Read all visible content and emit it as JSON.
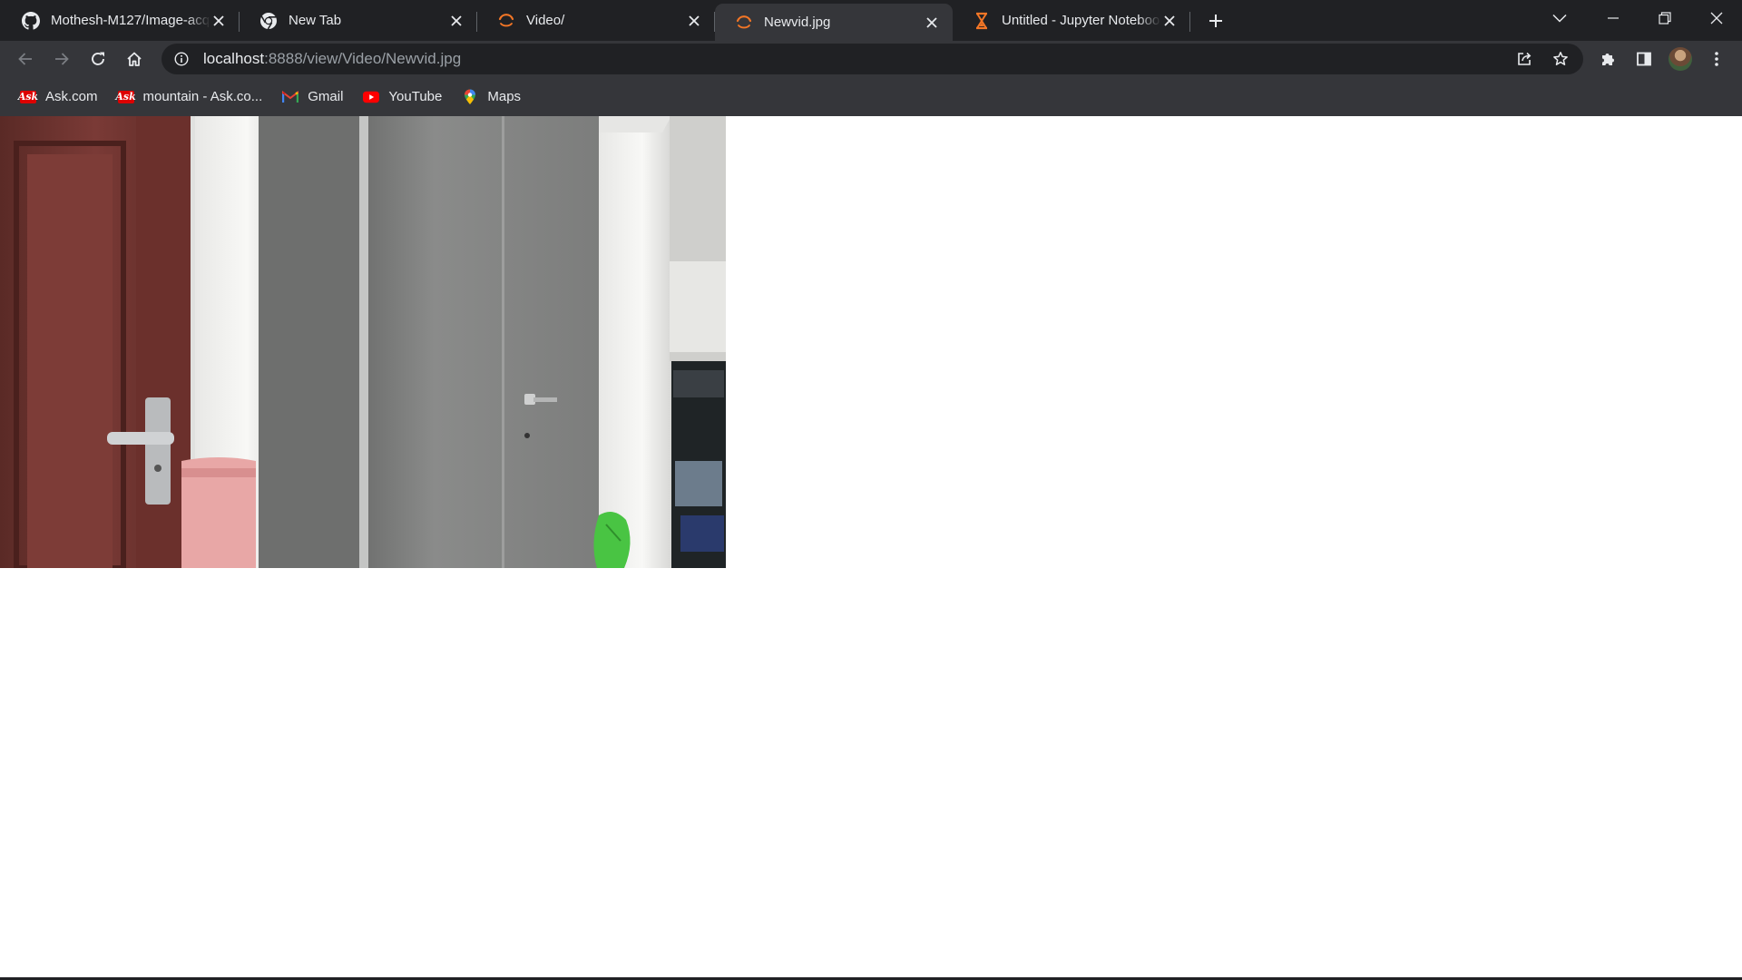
{
  "tabs": [
    {
      "title": "Mothesh-M127/Image-acq",
      "icon": "github-icon",
      "active": false
    },
    {
      "title": "New Tab",
      "icon": "chrome-icon",
      "active": false
    },
    {
      "title": "Video/",
      "icon": "jupyter-spinner-icon",
      "active": false
    },
    {
      "title": "Newvid.jpg",
      "icon": "jupyter-spinner-icon",
      "active": true
    },
    {
      "title": "Untitled - Jupyter Notebook",
      "icon": "hourglass-icon",
      "active": false
    }
  ],
  "address_bar": {
    "host": "localhost",
    "path": ":8888/view/Video/Newvid.jpg"
  },
  "bookmarks": [
    {
      "label": "Ask.com",
      "icon": "ask-icon"
    },
    {
      "label": "mountain - Ask.co...",
      "icon": "ask-icon"
    },
    {
      "label": "Gmail",
      "icon": "gmail-icon"
    },
    {
      "label": "YouTube",
      "icon": "youtube-icon"
    },
    {
      "label": "Maps",
      "icon": "maps-icon"
    }
  ],
  "content": {
    "image": "photo of a room: maroon door with silver handle, white pillar, grey steel cupboard, shelf with items"
  },
  "colors": {
    "tabstrip_bg": "#202124",
    "toolbar_bg": "#35363a",
    "omnibox_bg": "#202124",
    "text": "#e8eaed",
    "jupyter_orange": "#f37626",
    "page_bg": "#ffffff"
  }
}
